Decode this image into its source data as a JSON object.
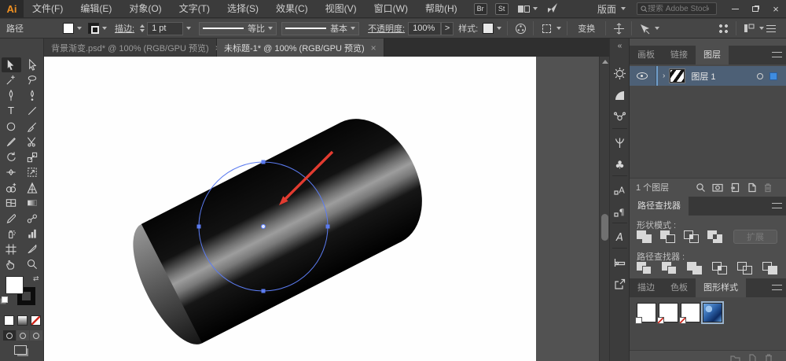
{
  "app": {
    "logo_text": "Ai"
  },
  "icons": {
    "close": "×",
    "collapse_dock": "«",
    "layer_expand": "›",
    "swap_colors": "⇄"
  },
  "menubar": {
    "items": [
      "文件(F)",
      "编辑(E)",
      "对象(O)",
      "文字(T)",
      "选择(S)",
      "效果(C)",
      "视图(V)",
      "窗口(W)",
      "帮助(H)"
    ],
    "bridge_badge": "Br",
    "stock_badge": "St",
    "workspace_label": "版面",
    "search_placeholder": "搜索 Adobe Stock"
  },
  "options_bar": {
    "context_label": "路径",
    "stroke_label": "描边:",
    "stroke_weight": "1 pt",
    "profile_value": "等比",
    "brush_value": "基本",
    "opacity_label": "不透明度:",
    "opacity_value": "100%",
    "more_button": ">",
    "style_label": "样式:",
    "transform_label": "变换"
  },
  "document_tabs": {
    "inactive_title": "背景渐变.psd* @ 100% (RGB/GPU 预览)",
    "active_title": "未标题-1* @ 100% (RGB/GPU 预览)"
  },
  "left_toolbar": {
    "active_tool": "selection",
    "tools": [
      "selection",
      "direct-selection",
      "magic-wand",
      "lasso",
      "pen",
      "curvature",
      "type",
      "line-segment",
      "ellipse",
      "paintbrush",
      "pencil",
      "scissors",
      "rotate",
      "scale",
      "width",
      "free-transform",
      "shape-builder",
      "perspective-grid",
      "mesh",
      "gradient",
      "eyedropper",
      "blend",
      "symbol-sprayer",
      "column-graph",
      "artboard",
      "slice",
      "hand",
      "zoom"
    ],
    "type_tool_glyph": "T"
  },
  "dock_icons": [
    "color",
    "color-guide",
    "asset-export",
    "brushes",
    "symbols",
    "character-styles",
    "paragraph-styles",
    "glyphs",
    "artboards",
    "export"
  ],
  "dock_glyphs": {
    "symbols": "♣",
    "character_styles": "A",
    "paragraph_styles": "¶",
    "glyphs": "A"
  },
  "layers_panel": {
    "tab_artboards": "画板",
    "tab_links": "链接",
    "tab_layers": "图层",
    "layer_name": "图层 1",
    "status": "1 个图层"
  },
  "pathfinder_panel": {
    "title": "路径查找器",
    "shape_modes_label": "形状模式 :",
    "pathfinder_label": "路径查找器 :",
    "expand_label": "扩展"
  },
  "styles_panel": {
    "tab_stroke": "描边",
    "tab_swatches": "色板",
    "tab_graphic_styles": "图形样式"
  },
  "canvas": {
    "artboard_color": "#fefefe",
    "cylinder_color": "#050505",
    "cylinder_highlight": "#9d9d9d",
    "selection_color": "#5b7bf0",
    "arrow_color": "#e23b30"
  }
}
